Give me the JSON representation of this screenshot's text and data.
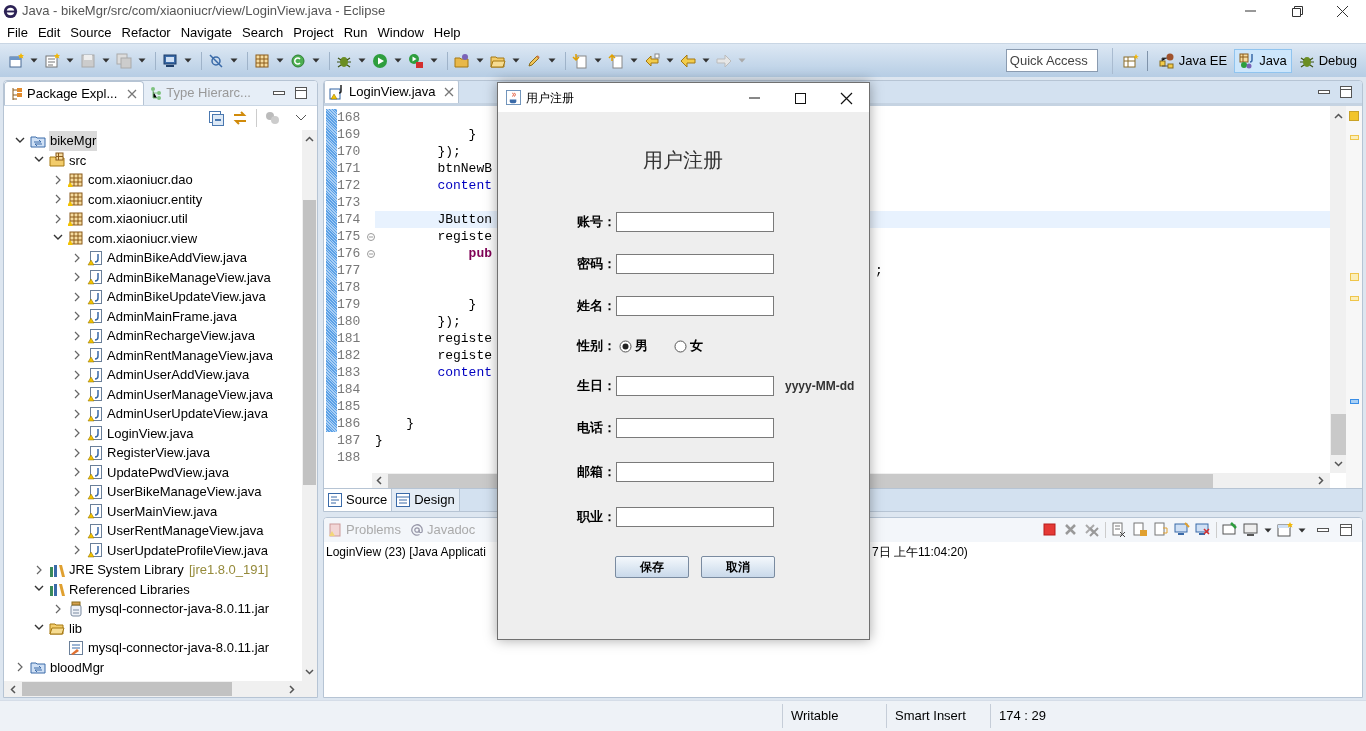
{
  "window": {
    "title": "Java - bikeMgr/src/com/xiaoniucr/view/LoginView.java - Eclipse"
  },
  "menu": [
    "File",
    "Edit",
    "Source",
    "Refactor",
    "Navigate",
    "Search",
    "Project",
    "Run",
    "Window",
    "Help"
  ],
  "quick_access": {
    "placeholder": "Quick Access"
  },
  "perspectives": [
    {
      "label": "Java EE",
      "selected": false
    },
    {
      "label": "Java",
      "selected": true
    },
    {
      "label": "Debug",
      "selected": false
    }
  ],
  "explorer": {
    "tabs": [
      {
        "label": "Package Expl...",
        "selected": true
      },
      {
        "label": "Type Hierarc...",
        "selected": false
      }
    ],
    "tree": [
      {
        "kind": "project",
        "label": "bikeMgr",
        "selected": true,
        "expanded": true,
        "children": [
          {
            "kind": "source-folder",
            "label": "src",
            "selected": false,
            "expanded": true,
            "children": [
              {
                "kind": "package",
                "label": "com.xiaoniucr.dao",
                "selected": false,
                "expanded": false
              },
              {
                "kind": "package",
                "label": "com.xiaoniucr.entity",
                "selected": false,
                "expanded": false
              },
              {
                "kind": "package",
                "label": "com.xiaoniucr.util",
                "selected": false,
                "expanded": false
              },
              {
                "kind": "package",
                "label": "com.xiaoniucr.view",
                "selected": false,
                "expanded": true,
                "children": [
                  {
                    "kind": "java-file",
                    "label": "AdminBikeAddView.java",
                    "selected": false,
                    "expanded": false
                  },
                  {
                    "kind": "java-file",
                    "label": "AdminBikeManageView.java",
                    "selected": false,
                    "expanded": false
                  },
                  {
                    "kind": "java-file",
                    "label": "AdminBikeUpdateView.java",
                    "selected": false,
                    "expanded": false
                  },
                  {
                    "kind": "java-file",
                    "label": "AdminMainFrame.java",
                    "selected": false,
                    "expanded": false
                  },
                  {
                    "kind": "java-file",
                    "label": "AdminRechargeView.java",
                    "selected": false,
                    "expanded": false
                  },
                  {
                    "kind": "java-file",
                    "label": "AdminRentManageView.java",
                    "selected": false,
                    "expanded": false
                  },
                  {
                    "kind": "java-file",
                    "label": "AdminUserAddView.java",
                    "selected": false,
                    "expanded": false
                  },
                  {
                    "kind": "java-file",
                    "label": "AdminUserManageView.java",
                    "selected": false,
                    "expanded": false
                  },
                  {
                    "kind": "java-file",
                    "label": "AdminUserUpdateView.java",
                    "selected": false,
                    "expanded": false
                  },
                  {
                    "kind": "java-file",
                    "label": "LoginView.java",
                    "selected": false,
                    "expanded": false
                  },
                  {
                    "kind": "java-file",
                    "label": "RegisterView.java",
                    "selected": false,
                    "expanded": false
                  },
                  {
                    "kind": "java-file",
                    "label": "UpdatePwdView.java",
                    "selected": false,
                    "expanded": false
                  },
                  {
                    "kind": "java-file",
                    "label": "UserBikeManageView.java",
                    "selected": false,
                    "expanded": false
                  },
                  {
                    "kind": "java-file",
                    "label": "UserMainView.java",
                    "selected": false,
                    "expanded": false
                  },
                  {
                    "kind": "java-file",
                    "label": "UserRentManageView.java",
                    "selected": false,
                    "expanded": false
                  },
                  {
                    "kind": "java-file",
                    "label": "UserUpdateProfileView.java",
                    "selected": false,
                    "expanded": false
                  }
                ]
              }
            ]
          },
          {
            "kind": "library",
            "label": "JRE System Library",
            "decoration": "[jre1.8.0_191]",
            "selected": false,
            "expanded": false
          },
          {
            "kind": "library",
            "label": "Referenced Libraries",
            "selected": false,
            "expanded": true,
            "children": [
              {
                "kind": "jar",
                "label": "mysql-connector-java-8.0.11.jar",
                "selected": false,
                "expanded": false
              }
            ]
          },
          {
            "kind": "folder",
            "label": "lib",
            "selected": false,
            "expanded": true,
            "children": [
              {
                "kind": "jar-file",
                "label": "mysql-connector-java-8.0.11.jar",
                "selected": false
              }
            ]
          }
        ]
      },
      {
        "kind": "project",
        "label": "bloodMgr",
        "selected": false,
        "expanded": false
      }
    ]
  },
  "editor": {
    "tab": "LoginView.java",
    "lines": [
      {
        "number": "168",
        "current": false
      },
      {
        "number": "169",
        "text": "            }",
        "kind": "plain",
        "current": false
      },
      {
        "number": "170",
        "text": "        });",
        "kind": "plain",
        "current": false
      },
      {
        "number": "171",
        "text": "        btnNewB",
        "kind": "plain",
        "current": false
      },
      {
        "number": "172",
        "text": "        content",
        "kind": "field",
        "current": false
      },
      {
        "number": "173",
        "current": false
      },
      {
        "number": "174",
        "text": "        JButton",
        "kind": "plain",
        "current": true
      },
      {
        "number": "175",
        "text": "        registe",
        "kind": "plain",
        "current": false,
        "fold": true
      },
      {
        "number": "176",
        "text": "            pub",
        "kind": "keyword",
        "current": false,
        "fold": true
      },
      {
        "number": "177",
        "tail": ";",
        "current": false
      },
      {
        "number": "178",
        "current": false
      },
      {
        "number": "179",
        "text": "            }",
        "kind": "plain",
        "current": false
      },
      {
        "number": "180",
        "text": "        });",
        "kind": "plain",
        "current": false
      },
      {
        "number": "181",
        "text": "        registe",
        "kind": "plain",
        "current": false
      },
      {
        "number": "182",
        "text": "        registe",
        "kind": "plain",
        "current": false
      },
      {
        "number": "183",
        "text": "        content",
        "kind": "field",
        "current": false
      },
      {
        "number": "184",
        "current": false
      },
      {
        "number": "185",
        "current": false
      },
      {
        "number": "186",
        "text": "    }",
        "kind": "plain",
        "current": false
      },
      {
        "number": "187",
        "text": "}",
        "kind": "plain",
        "current": false
      },
      {
        "number": "188",
        "current": false
      }
    ],
    "bottom_tabs": [
      {
        "label": "Source",
        "selected": true
      },
      {
        "label": "Design",
        "selected": false
      }
    ]
  },
  "console": {
    "tabs": [
      "Problems",
      "Javadoc"
    ],
    "text_left": "LoginView (23) [Java Applicati",
    "text_right": "7日 上午11:04:20)"
  },
  "status_bar": [
    "Writable",
    "Smart Insert",
    "174 : 29"
  ],
  "dialog": {
    "title": "用户注册",
    "heading": "用户注册",
    "fields": [
      {
        "kind": "text",
        "label": "账号："
      },
      {
        "kind": "text",
        "label": "密码："
      },
      {
        "kind": "text",
        "label": "姓名："
      },
      {
        "kind": "radio",
        "label": "性别：",
        "options": [
          {
            "label": "男",
            "selected": true
          },
          {
            "label": "女",
            "selected": false
          }
        ]
      },
      {
        "kind": "text",
        "label": "生日：",
        "hint": "yyyy-MM-dd"
      },
      {
        "kind": "text",
        "label": "电话："
      },
      {
        "kind": "text",
        "label": "邮箱："
      },
      {
        "kind": "text",
        "label": "职业："
      }
    ],
    "buttons": [
      "保存",
      "取消"
    ]
  }
}
